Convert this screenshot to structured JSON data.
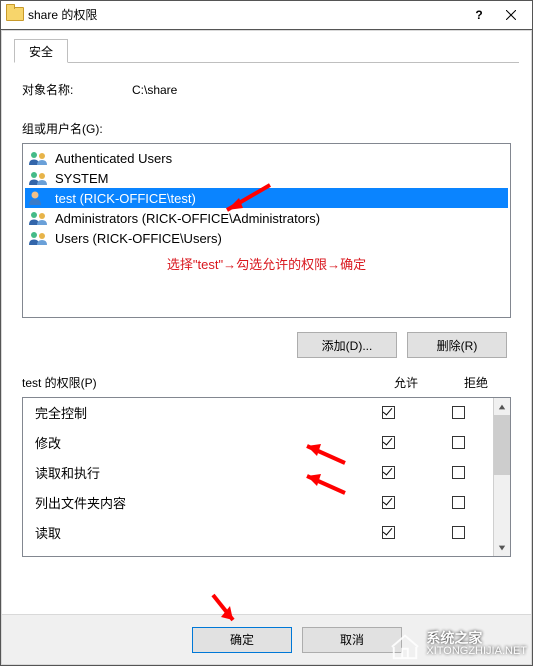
{
  "title": "share 的权限",
  "tab": {
    "label": "安全"
  },
  "object": {
    "label": "对象名称:",
    "value": "C:\\share"
  },
  "groups": {
    "label": "组或用户名(G):",
    "items": [
      {
        "name": "Authenticated Users",
        "type": "group"
      },
      {
        "name": "SYSTEM",
        "type": "group"
      },
      {
        "name": "test (RICK-OFFICE\\test)",
        "type": "user",
        "selected": true
      },
      {
        "name": "Administrators (RICK-OFFICE\\Administrators)",
        "type": "group"
      },
      {
        "name": "Users (RICK-OFFICE\\Users)",
        "type": "group"
      }
    ],
    "annotation": "选择\"test\"→勾选允许的权限→确定"
  },
  "buttons": {
    "add": "添加(D)...",
    "remove": "删除(R)"
  },
  "permissions": {
    "label": "test 的权限(P)",
    "col_allow": "允许",
    "col_deny": "拒绝",
    "rows": [
      {
        "name": "完全控制",
        "allow": true,
        "deny": false
      },
      {
        "name": "修改",
        "allow": true,
        "deny": false
      },
      {
        "name": "读取和执行",
        "allow": true,
        "deny": false
      },
      {
        "name": "列出文件夹内容",
        "allow": true,
        "deny": false
      },
      {
        "name": "读取",
        "allow": true,
        "deny": false
      }
    ]
  },
  "bottom": {
    "ok": "确定",
    "cancel": "取消"
  },
  "watermark": {
    "line1": "系统之家",
    "line2": "XITONGZHIJIA.NET"
  }
}
